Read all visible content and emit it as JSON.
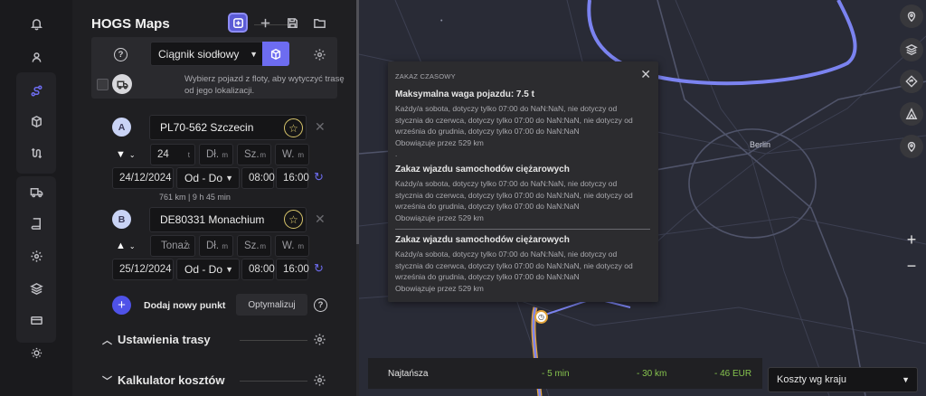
{
  "app": {
    "title": "HOGS Maps"
  },
  "rail": {
    "icons": [
      "bell-icon",
      "user-icon",
      "route-icon",
      "box-icon",
      "swap-route-icon",
      "truck-icon",
      "book-icon",
      "gear-icon",
      "layers-icon",
      "card-icon",
      "sun-icon"
    ],
    "active": "route-icon"
  },
  "header_actions": [
    "route-add-icon",
    "plus-icon",
    "save-icon",
    "folder-icon"
  ],
  "vehicle": {
    "selected": "Ciągnik siodłowy",
    "hint": "Wybierz pojazd z floty, aby wytyczyć trasę od jego lokalizacji."
  },
  "points": [
    {
      "badge": "A",
      "address": "PL70-562 Szczecin",
      "direction": "▼",
      "weight_value": "24",
      "weight_unit": "t",
      "length_placeholder": "Dł.",
      "length_unit": "m",
      "width_placeholder": "Sz.",
      "width_unit": "m",
      "height_placeholder": "W.",
      "height_unit": "m",
      "date": "24/12/2024",
      "time_mode": "Od - Do",
      "time_from": "08:00",
      "time_to": "16:00"
    },
    {
      "badge": "B",
      "address": "DE80331 Monachium",
      "direction": "▲",
      "weight_placeholder": "Tonaż",
      "weight_unit": "t",
      "length_placeholder": "Dł.",
      "length_unit": "m",
      "width_placeholder": "Sz.",
      "width_unit": "m",
      "height_placeholder": "W.",
      "height_unit": "m",
      "date": "25/12/2024",
      "time_mode": "Od - Do",
      "time_from": "08:00",
      "time_to": "16:00"
    }
  ],
  "leg_info": "761 km | 9 h 45 min",
  "actions": {
    "add_point": "Dodaj nowy punkt",
    "optimize": "Optymalizuj"
  },
  "sections": {
    "route_settings": "Ustawienia trasy",
    "cost_calculator": "Kalkulator kosztów"
  },
  "map": {
    "city": "Berlin",
    "popup": {
      "title": "ZAKAZ CZASOWY",
      "entries": [
        {
          "heading": "Maksymalna waga pojazdu: 7.5 t",
          "lines": [
            "Każdy/a sobota, dotyczy tylko 07:00 do NaN:NaN, nie dotyczy od",
            "stycznia do czerwca, dotyczy tylko 07:00 do NaN:NaN, nie dotyczy od",
            "września do grudnia, dotyczy tylko 07:00 do NaN:NaN"
          ],
          "footer": "Obowiązuje przez 529 km"
        },
        {
          "heading": "Zakaz wjazdu samochodów ciężarowych",
          "lines": [
            "Każdy/a sobota, dotyczy tylko 07:00 do NaN:NaN, nie dotyczy od",
            "stycznia do czerwca, dotyczy tylko 07:00 do NaN:NaN, nie dotyczy od",
            "września do grudnia, dotyczy tylko 07:00 do NaN:NaN"
          ],
          "footer": "Obowiązuje przez 529 km"
        },
        {
          "heading": "Zakaz wjazdu samochodów ciężarowych",
          "lines": [
            "Każdy/a sobota, dotyczy tylko 07:00 do NaN:NaN, nie dotyczy od",
            "stycznia do czerwca, dotyczy tylko 07:00 do NaN:NaN, nie dotyczy od",
            "września do grudnia, dotyczy tylko 07:00 do NaN:NaN"
          ],
          "footer": "Obowiązuje przez 529 km"
        }
      ],
      "separator": "."
    },
    "controls": [
      "pin-icon",
      "layers-icon",
      "directions-icon",
      "roadwork-icon",
      "location-icon"
    ],
    "zoom_in": "+",
    "zoom_out": "−"
  },
  "summary": {
    "label": "Najtańsza",
    "time": "- 5 min",
    "distance": "- 30 km",
    "cost": "- 46 EUR"
  },
  "cost_select": {
    "selected": "Koszty wg kraju"
  },
  "colors": {
    "accent": "#6d6cf0",
    "route": "#7b83f0",
    "positive": "#86c34e"
  }
}
